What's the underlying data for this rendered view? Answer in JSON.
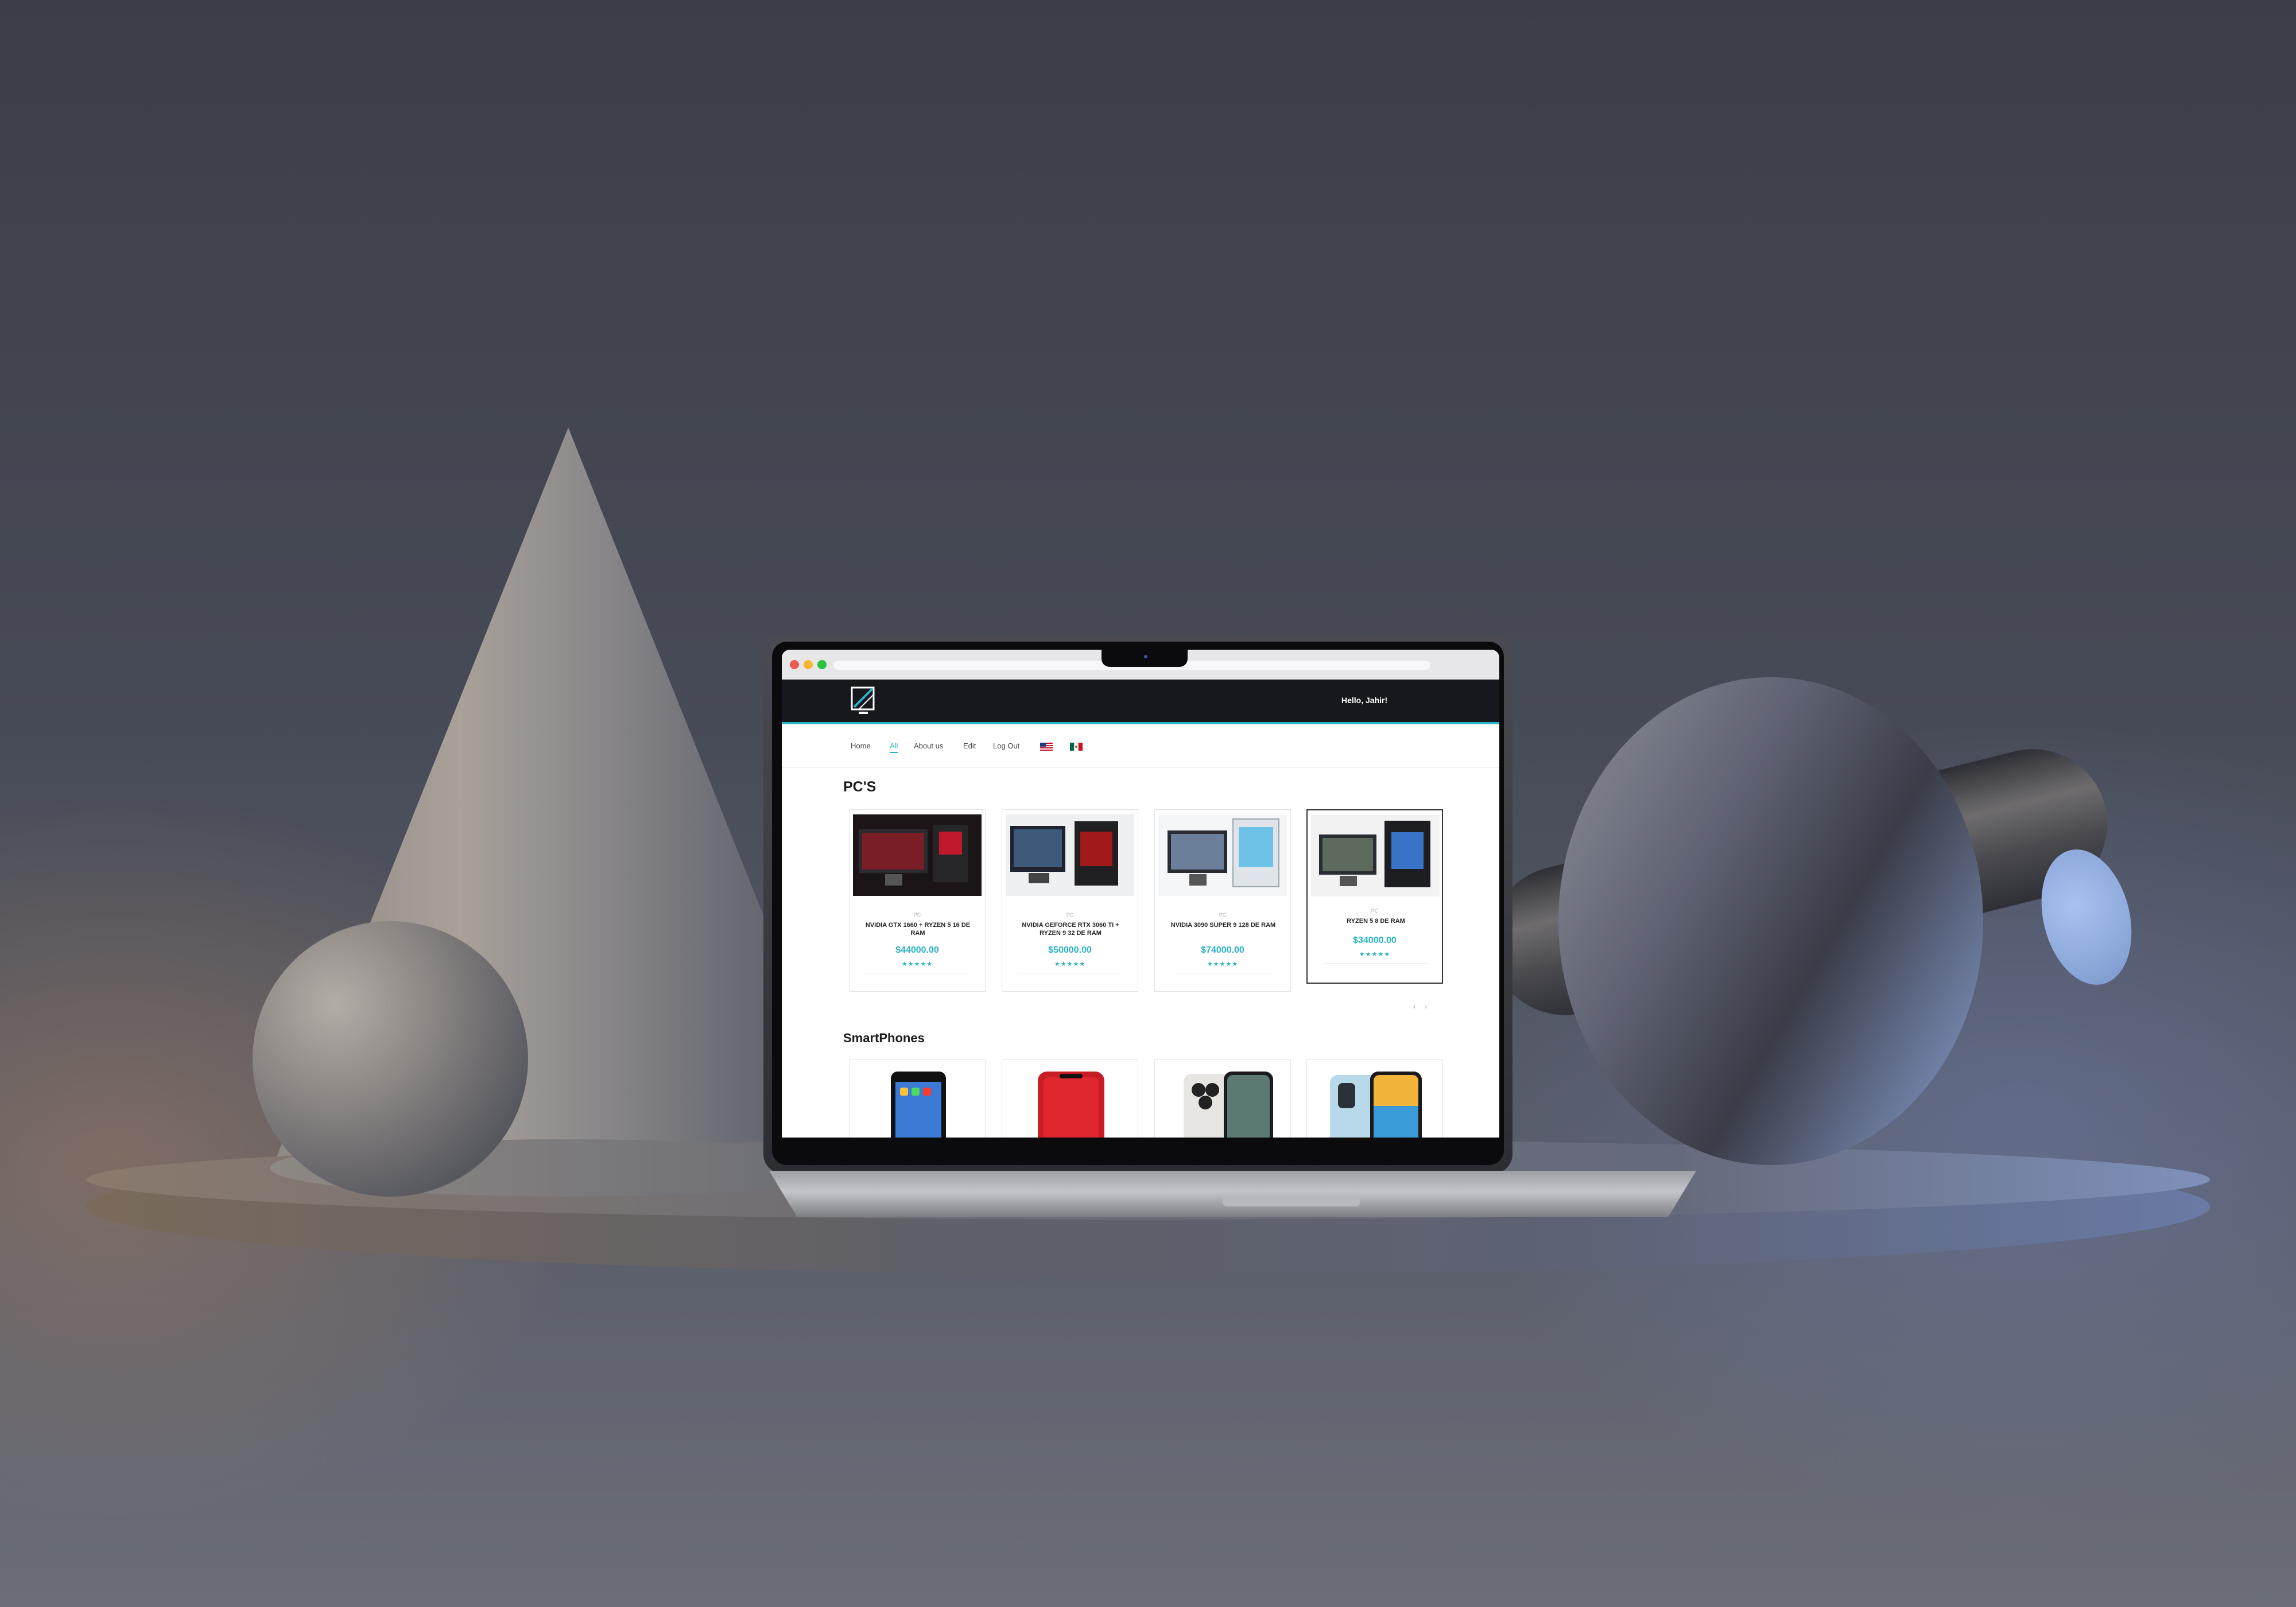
{
  "browser": {
    "url": ""
  },
  "site": {
    "header": {
      "greeting": "Hello, Jahir!"
    },
    "nav": {
      "items": [
        "Home",
        "All",
        "About us",
        "Edit",
        "Log Out"
      ],
      "active": "All",
      "flags": [
        "us-flag-icon",
        "mexico-flag-icon"
      ]
    },
    "sections": [
      {
        "title": "PC'S",
        "products": [
          {
            "category": "PC",
            "name": "NVIDIA GTX 1660 + RYZEN 5 16 DE RAM",
            "price": "$44000.00",
            "rating": "★★★★★"
          },
          {
            "category": "PC",
            "name": "NVIDIA GEFORCE RTX 3060 TI + RYZEN 9 32 DE RAM",
            "price": "$50000.00",
            "rating": "★★★★★"
          },
          {
            "category": "PC",
            "name": "NVIDIA 3090 SUPER 9 128 DE RAM",
            "price": "$74000.00",
            "rating": "★★★★★"
          },
          {
            "category": "PC",
            "name": "RYZEN 5 8 DE RAM",
            "price": "$34000.00",
            "rating": "★★★★★"
          }
        ],
        "pager": {
          "prev": "‹",
          "next": "›"
        }
      },
      {
        "title": "SmartPhones",
        "products": [
          {
            "image": "iphone-8-black"
          },
          {
            "image": "iphone-xr-red"
          },
          {
            "image": "iphone-11-pro-silver"
          },
          {
            "image": "iphone-12-blue"
          }
        ]
      }
    ]
  },
  "colors": {
    "accent": "#2bb3c6",
    "topbar": "#16181d"
  }
}
